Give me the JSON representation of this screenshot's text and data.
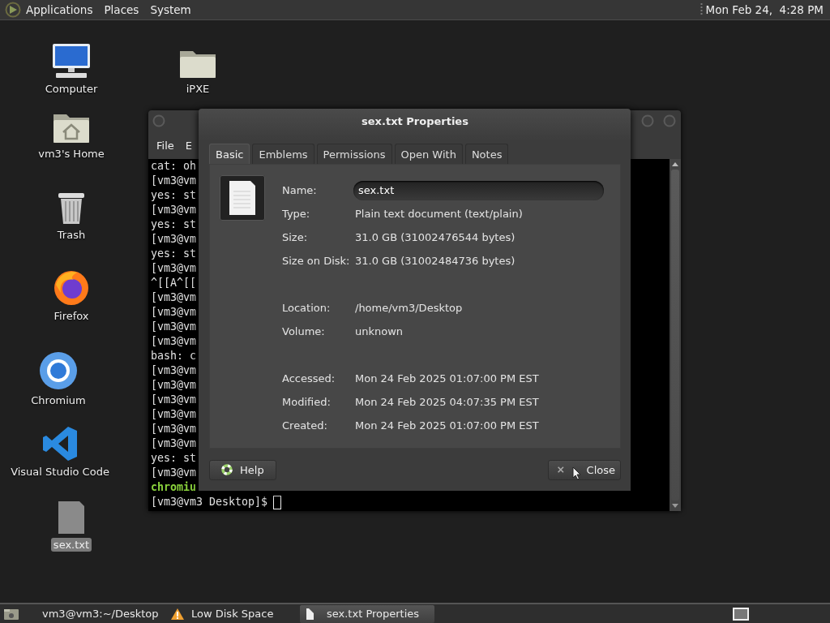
{
  "top_panel": {
    "menus": [
      "Applications",
      "Places",
      "System"
    ],
    "clock": "Mon Feb 24,  4:28 PM"
  },
  "desktop_icons": [
    {
      "label": "Computer",
      "kind": "computer",
      "selected": false
    },
    {
      "label": "iPXE",
      "kind": "folder",
      "selected": false
    },
    {
      "label": "vm3's Home",
      "kind": "home",
      "selected": false
    },
    {
      "label": "Trash",
      "kind": "trash",
      "selected": false
    },
    {
      "label": "Firefox",
      "kind": "firefox",
      "selected": false
    },
    {
      "label": "Chromium",
      "kind": "chromium",
      "selected": false
    },
    {
      "label": "Visual Studio Code",
      "kind": "vscode",
      "selected": false
    },
    {
      "label": "sex.txt",
      "kind": "document",
      "selected": true
    }
  ],
  "terminal": {
    "menu": [
      "File",
      "E"
    ],
    "lines": [
      {
        "text": "cat: oh",
        "kind": "plain"
      },
      {
        "text": "[vm3@vm",
        "kind": "plain"
      },
      {
        "text": "yes: st",
        "kind": "plain"
      },
      {
        "text": "[vm3@vm",
        "kind": "plain"
      },
      {
        "text": "yes: st",
        "kind": "plain"
      },
      {
        "text": "[vm3@vm",
        "kind": "plain"
      },
      {
        "text": "yes: st",
        "kind": "plain"
      },
      {
        "text": "[vm3@vm",
        "kind": "plain"
      },
      {
        "text": "^[[A^[[",
        "kind": "plain"
      },
      {
        "text": "[vm3@vm",
        "kind": "plain"
      },
      {
        "text": "[vm3@vm",
        "kind": "plain"
      },
      {
        "text": "[vm3@vm",
        "kind": "plain"
      },
      {
        "text": "[vm3@vm",
        "kind": "plain"
      },
      {
        "text": "bash: c",
        "kind": "plain"
      },
      {
        "text": "[vm3@vm",
        "kind": "plain"
      },
      {
        "text": "[vm3@vm",
        "kind": "plain"
      },
      {
        "text": "[vm3@vm",
        "kind": "plain"
      },
      {
        "text": "[vm3@vm",
        "kind": "plain"
      },
      {
        "text": "[vm3@vm",
        "kind": "plain"
      },
      {
        "text": "[vm3@vm",
        "kind": "plain"
      },
      {
        "text": "yes: st",
        "kind": "plain"
      },
      {
        "text": "[vm3@vm",
        "kind": "plain"
      },
      {
        "text": "chromiu",
        "kind": "highlight"
      }
    ],
    "prompt": "[vm3@vm3 Desktop]$"
  },
  "dialog": {
    "title": "sex.txt Properties",
    "tabs": [
      {
        "label": "Basic",
        "selected": true
      },
      {
        "label": "Emblems",
        "selected": false
      },
      {
        "label": "Permissions",
        "selected": false
      },
      {
        "label": "Open With",
        "selected": false
      },
      {
        "label": "Notes",
        "selected": false
      }
    ],
    "sections": [
      {
        "fields": [
          {
            "label": "Name:",
            "value": "sex.txt",
            "kind": "entry"
          },
          {
            "label": "Type:",
            "value": "Plain text document (text/plain)",
            "kind": "text"
          },
          {
            "label": "Size:",
            "value": "31.0 GB (31002476544 bytes)",
            "kind": "text"
          },
          {
            "label": "Size on Disk:",
            "value": "31.0 GB (31002484736 bytes)",
            "kind": "text"
          }
        ]
      },
      {
        "fields": [
          {
            "label": "Location:",
            "value": "/home/vm3/Desktop",
            "kind": "text"
          },
          {
            "label": "Volume:",
            "value": "unknown",
            "kind": "text"
          }
        ]
      },
      {
        "fields": [
          {
            "label": "Accessed:",
            "value": "Mon 24 Feb 2025 01:07:00 PM EST",
            "kind": "text"
          },
          {
            "label": "Modified:",
            "value": "Mon 24 Feb 2025 04:07:35 PM EST",
            "kind": "text"
          },
          {
            "label": "Created:",
            "value": "Mon 24 Feb 2025 01:07:00 PM EST",
            "kind": "text"
          }
        ]
      }
    ],
    "buttons": [
      {
        "label": "Help",
        "kind": "help"
      },
      {
        "label": "Close",
        "kind": "close"
      }
    ]
  },
  "taskbar": {
    "tasks": [
      {
        "label": "vm3@vm3:~/Desktop",
        "kind": "terminal",
        "selected": false
      },
      {
        "label": "Low Disk Space",
        "kind": "warning",
        "selected": false
      },
      {
        "label": "sex.txt Properties",
        "kind": "document",
        "selected": true
      }
    ]
  }
}
